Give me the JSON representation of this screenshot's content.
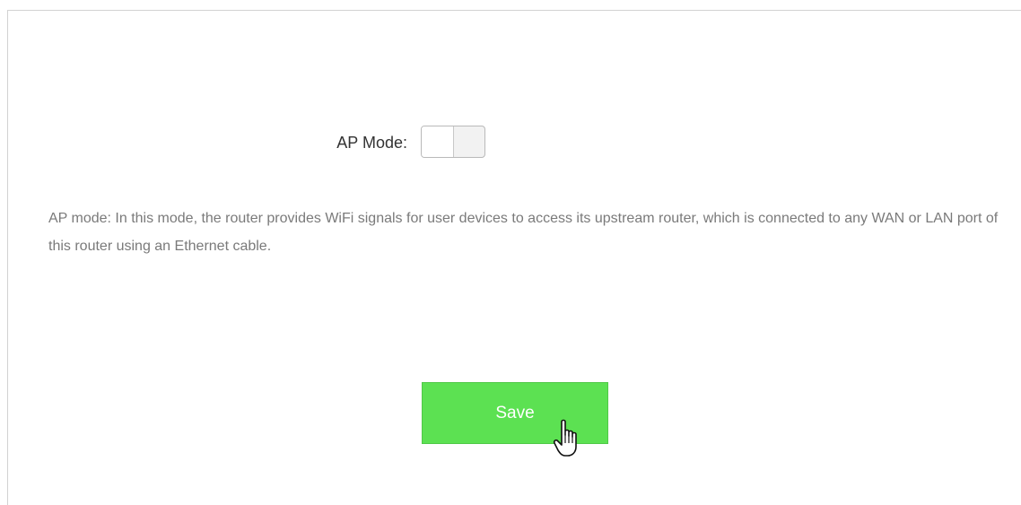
{
  "ap_mode": {
    "label": "AP Mode:",
    "enabled": false
  },
  "description": "AP mode: In this mode, the router provides WiFi signals for user devices to access its upstream router, which is connected to any WAN or LAN port of this router using an Ethernet cable.",
  "save_button": {
    "label": "Save",
    "color": "#5ce152"
  },
  "cursor": {
    "icon": "hand-pointer-icon"
  }
}
